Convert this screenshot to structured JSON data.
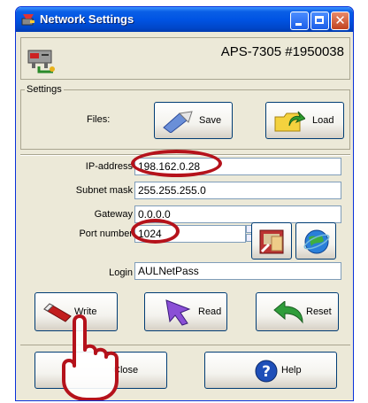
{
  "window": {
    "title": "Network Settings"
  },
  "device": {
    "name": "APS-7305 #1950038"
  },
  "settings": {
    "legend": "Settings",
    "files_label": "Files:",
    "save_label": "Save",
    "load_label": "Load"
  },
  "network": {
    "ip_label": "IP-address",
    "ip_value": "198.162.0.28",
    "subnet_label": "Subnet mask",
    "subnet_value": "255.255.255.0",
    "gateway_label": "Gateway",
    "gateway_value": "0.0.0.0",
    "port_label": "Port number",
    "port_value": "1024",
    "login_label": "Login",
    "login_value": "AULNetPass"
  },
  "actions": {
    "write_label": "Write",
    "read_label": "Read",
    "reset_label": "Reset"
  },
  "footer": {
    "close_label": "Close",
    "help_label": "Help"
  },
  "colors": {
    "highlight_ring": "#b5121b",
    "title_bar": "#0054e3"
  }
}
